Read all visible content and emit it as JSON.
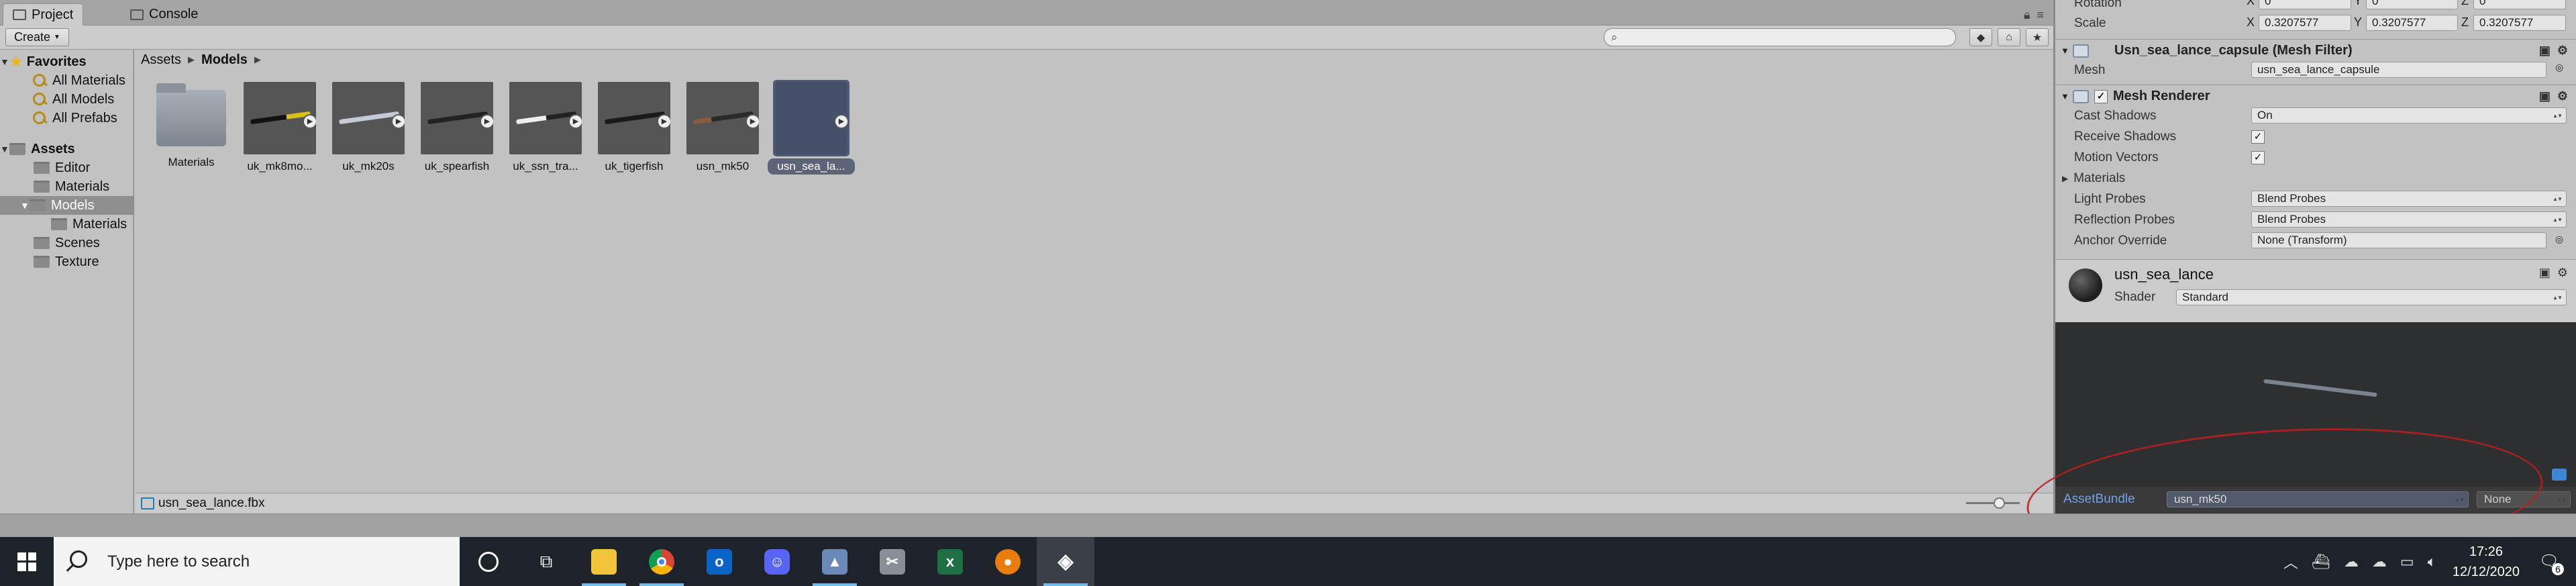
{
  "project_panel": {
    "tabs": [
      {
        "label": "Project"
      },
      {
        "label": "Console"
      }
    ],
    "create_label": "Create",
    "tree": {
      "favorites_label": "Favorites",
      "favorites": [
        {
          "label": "All Materials"
        },
        {
          "label": "All Models"
        },
        {
          "label": "All Prefabs"
        }
      ],
      "assets_label": "Assets",
      "assets": [
        {
          "label": "Editor"
        },
        {
          "label": "Materials"
        },
        {
          "label": "Models"
        },
        {
          "label": "Materials"
        },
        {
          "label": "Scenes"
        },
        {
          "label": "Texture"
        }
      ]
    },
    "breadcrumb": [
      "Assets",
      "Models"
    ],
    "items": [
      {
        "label": "Materials"
      },
      {
        "label": "uk_mk8mo..."
      },
      {
        "label": "uk_mk20s"
      },
      {
        "label": "uk_spearfish"
      },
      {
        "label": "uk_ssn_tra..."
      },
      {
        "label": "uk_tigerfish"
      },
      {
        "label": "usn_mk50"
      },
      {
        "label": "usn_sea_la..."
      }
    ],
    "selected_item": "usn_sea_la...",
    "footer_path": "usn_sea_lance.fbx"
  },
  "inspector": {
    "rotation_label": "Rotation",
    "rotation": {
      "x": "0",
      "y": "0",
      "z": "0"
    },
    "scale_label": "Scale",
    "scale": {
      "x": "0.3207577",
      "y": "0.3207577",
      "z": "0.3207577"
    },
    "axis_x": "X",
    "axis_y": "Y",
    "axis_z": "Z",
    "mesh_filter": {
      "title": "Usn_sea_lance_capsule (Mesh Filter)",
      "mesh_label": "Mesh",
      "mesh_value": "usn_sea_lance_capsule"
    },
    "mesh_renderer": {
      "title": "Mesh Renderer",
      "cast_shadows_label": "Cast Shadows",
      "cast_shadows_value": "On",
      "receive_shadows_label": "Receive Shadows",
      "motion_vectors_label": "Motion Vectors",
      "materials_label": "Materials",
      "light_probes_label": "Light Probes",
      "light_probes_value": "Blend Probes",
      "reflection_probes_label": "Reflection Probes",
      "reflection_probes_value": "Blend Probes",
      "anchor_override_label": "Anchor Override",
      "anchor_override_value": "None (Transform)"
    },
    "material": {
      "name": "usn_sea_lance",
      "shader_label": "Shader",
      "shader_value": "Standard"
    },
    "asset_bundle": {
      "label": "AssetBundle",
      "value": "usn_mk50",
      "variant": "None"
    }
  },
  "taskbar": {
    "search_placeholder": "Type here to search",
    "time": "17:26",
    "date": "12/12/2020",
    "notification_count": "6",
    "apps": [
      {
        "name": "task-view"
      },
      {
        "name": "file-explorer"
      },
      {
        "name": "chrome"
      },
      {
        "name": "outlook"
      },
      {
        "name": "discord"
      },
      {
        "name": "photos"
      },
      {
        "name": "snipping-tool"
      },
      {
        "name": "excel"
      },
      {
        "name": "blender"
      },
      {
        "name": "unity"
      }
    ]
  },
  "colors": {
    "panel_bg": "#c2c2c2",
    "selection": "#5c6478",
    "accent_blue": "#6fa2e6",
    "annotation_red": "#b81e1e",
    "taskbar_bg": "#1e2329"
  }
}
